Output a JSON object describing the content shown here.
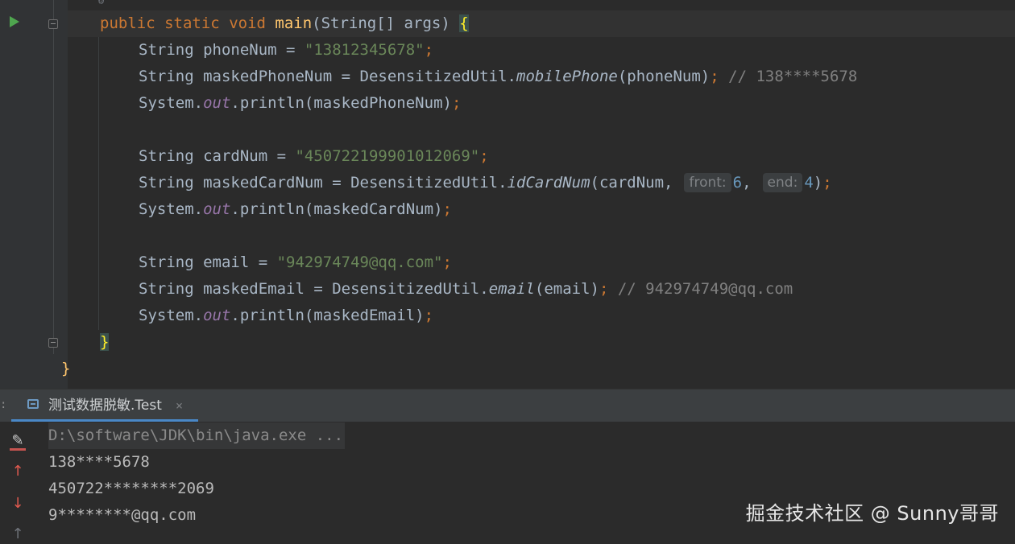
{
  "editor": {
    "lines": {
      "main_sig": {
        "public": "public",
        "static": "static",
        "void": "void",
        "name": "main",
        "params": "(String[] args) ",
        "brace": "{"
      },
      "l1": {
        "decl": "String phoneNum = ",
        "value": "\"13812345678\"",
        "semi": ";"
      },
      "l2": {
        "decl": "String maskedPhoneNum = DesensitizedUtil.",
        "method": "mobilePhone",
        "args": "(phoneNum)",
        "semi": ";",
        "comment": " // 138****5678"
      },
      "l3": {
        "prefix": "System.",
        "field": "out",
        "call": ".println(maskedPhoneNum)",
        "semi": ";"
      },
      "l4": {
        "decl": "String cardNum = ",
        "value": "\"450722199901012069\"",
        "semi": ";"
      },
      "l5": {
        "decl": "String maskedCardNum = DesensitizedUtil.",
        "method": "idCardNum",
        "args_open": "(cardNum,",
        "hint_front": "front:",
        "front_value": "6",
        "comma": ",",
        "hint_end": "end:",
        "end_value": "4",
        "args_close": ")",
        "semi": ";"
      },
      "l6": {
        "prefix": "System.",
        "field": "out",
        "call": ".println(maskedCardNum)",
        "semi": ";"
      },
      "l7": {
        "decl": "String email = ",
        "value": "\"942974749@qq.com\"",
        "semi": ";"
      },
      "l8": {
        "decl": "String maskedEmail = DesensitizedUtil.",
        "method": "email",
        "args": "(email)",
        "semi": ";",
        "comment": " // 942974749@qq.com"
      },
      "l9": {
        "prefix": "System.",
        "field": "out",
        "call": ".println(maskedEmail)",
        "semi": ";"
      },
      "method_close": "}",
      "class_close": "}"
    }
  },
  "run_panel": {
    "tab_label": "测试数据脱敏.Test",
    "tab_close": "×",
    "console": {
      "command": "D:\\software\\JDK\\bin\\java.exe ...",
      "output": [
        "138****5678",
        "450722********2069",
        "9********@qq.com"
      ]
    },
    "toolbar": {
      "clear_glyph": "✎",
      "up_glyph": "↑",
      "down_glyph": "↓",
      "scroll_glyph": "↑"
    }
  },
  "watermark": "掘金技术社区 @ Sunny哥哥",
  "colors": {
    "background": "#2b2b2b",
    "keyword": "#cc7832",
    "method_name": "#ffc66d",
    "string": "#6a8759",
    "number": "#6897bb",
    "comment": "#808080",
    "field": "#9876aa",
    "text": "#a9b7c6",
    "run_icon": "#4fa64f",
    "tab_underline": "#4a88c7"
  }
}
